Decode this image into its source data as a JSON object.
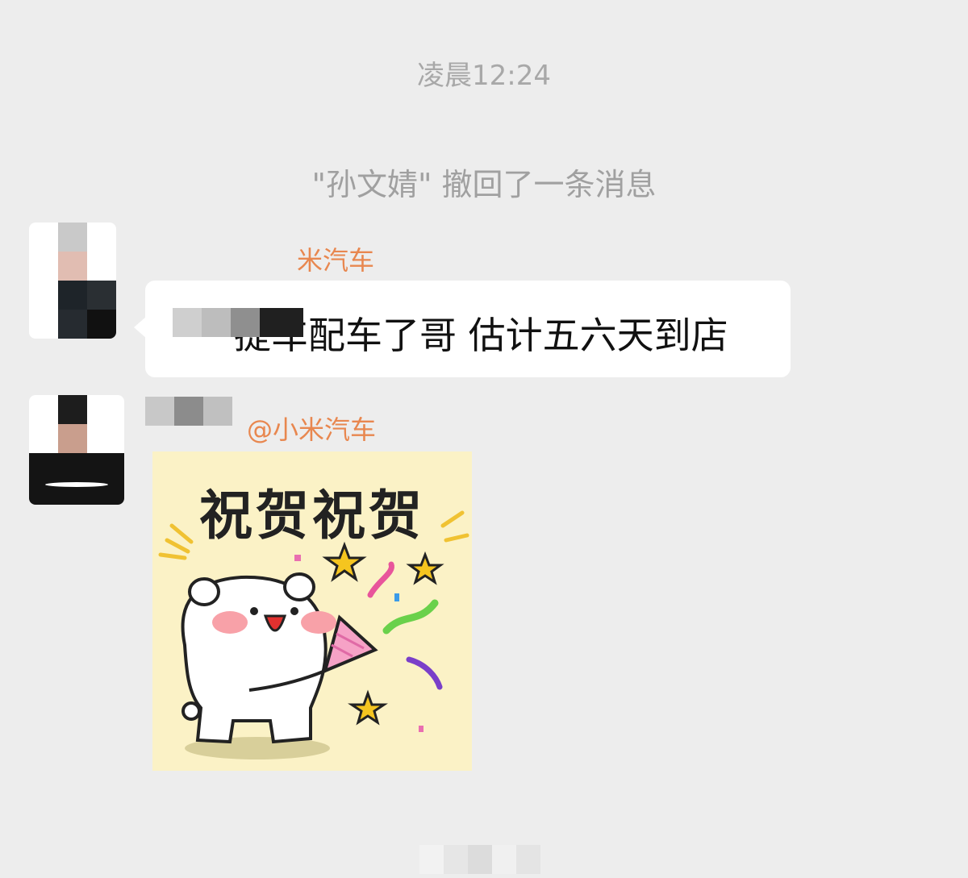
{
  "chat": {
    "timestamp": "凌晨12:24",
    "system_message": "\"孙文婧\" 撤回了一条消息",
    "messages": [
      {
        "sender_name": "米汽车",
        "text": "提车配车了哥 估计五六天到店"
      },
      {
        "sender_name": "@小米汽车",
        "sticker_caption": "祝贺祝贺"
      }
    ]
  },
  "colors": {
    "background": "#ededed",
    "bubble": "#ffffff",
    "sender_name": "#e8874f",
    "sticker_bg": "#fbf2c6"
  }
}
